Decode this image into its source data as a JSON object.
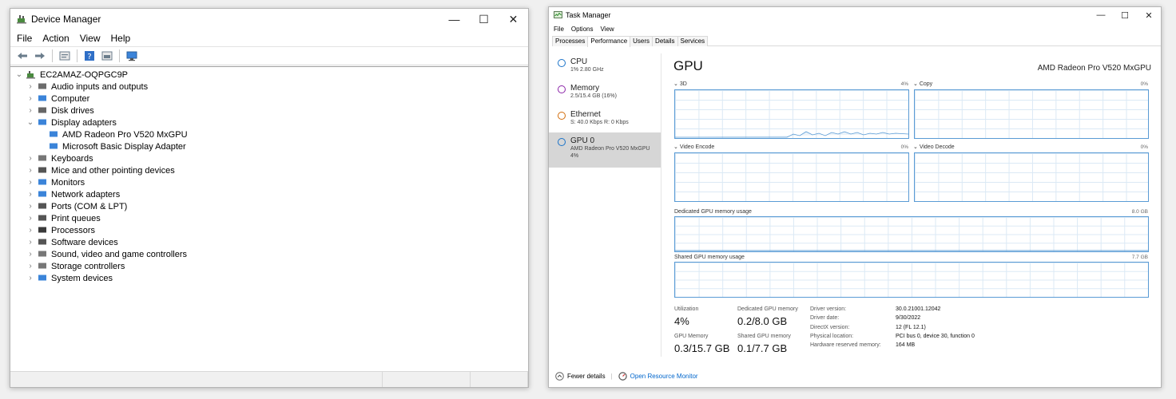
{
  "device_manager": {
    "title": "Device Manager",
    "caption": {
      "minimize": "—",
      "maximize": "☐",
      "close": "✕"
    },
    "menu": [
      "File",
      "Action",
      "View",
      "Help"
    ],
    "toolbar_icons": [
      "back-icon",
      "forward-icon",
      "properties-icon",
      "help-icon",
      "update-driver-icon",
      "monitor-icon"
    ],
    "root": "EC2AMAZ-OQPGC9P",
    "tree": [
      {
        "label": "Audio inputs and outputs",
        "icon": "speaker-icon",
        "expanded": false
      },
      {
        "label": "Computer",
        "icon": "computer-icon",
        "expanded": false
      },
      {
        "label": "Disk drives",
        "icon": "disk-icon",
        "expanded": false
      },
      {
        "label": "Display adapters",
        "icon": "display-adapter-icon",
        "expanded": true,
        "children": [
          "AMD Radeon Pro V520 MxGPU",
          "Microsoft Basic Display Adapter"
        ]
      },
      {
        "label": "Keyboards",
        "icon": "keyboard-icon",
        "expanded": false
      },
      {
        "label": "Mice and other pointing devices",
        "icon": "mouse-icon",
        "expanded": false
      },
      {
        "label": "Monitors",
        "icon": "monitor-icon",
        "expanded": false
      },
      {
        "label": "Network adapters",
        "icon": "network-icon",
        "expanded": false
      },
      {
        "label": "Ports (COM & LPT)",
        "icon": "port-icon",
        "expanded": false
      },
      {
        "label": "Print queues",
        "icon": "printer-icon",
        "expanded": false
      },
      {
        "label": "Processors",
        "icon": "processor-icon",
        "expanded": false
      },
      {
        "label": "Software devices",
        "icon": "software-device-icon",
        "expanded": false
      },
      {
        "label": "Sound, video and game controllers",
        "icon": "sound-icon",
        "expanded": false
      },
      {
        "label": "Storage controllers",
        "icon": "storage-icon",
        "expanded": false
      },
      {
        "label": "System devices",
        "icon": "system-devices-icon",
        "expanded": false
      }
    ]
  },
  "task_manager": {
    "title": "Task Manager",
    "caption": {
      "minimize": "—",
      "maximize": "☐",
      "close": "✕"
    },
    "menu": [
      "File",
      "Options",
      "View"
    ],
    "tabs": [
      {
        "label": "Processes",
        "active": false
      },
      {
        "label": "Performance",
        "active": true
      },
      {
        "label": "Users",
        "active": false
      },
      {
        "label": "Details",
        "active": false
      },
      {
        "label": "Services",
        "active": false
      }
    ],
    "sidebar": [
      {
        "name": "CPU",
        "sub": "1% 2.80 GHz",
        "color": "#1a73c9",
        "selected": false
      },
      {
        "name": "Memory",
        "sub": "2.5/15.4 GB (16%)",
        "color": "#8b23a8",
        "selected": false
      },
      {
        "name": "Ethernet",
        "sub": "S: 40.0 Kbps R: 0 Kbps",
        "color": "#d26c0a",
        "selected": false
      },
      {
        "name": "GPU 0",
        "sub": "AMD Radeon Pro V520 MxGPU",
        "sub2": "4%",
        "color": "#1a73c9",
        "selected": true
      }
    ],
    "main": {
      "title": "GPU",
      "gpu_name": "AMD Radeon Pro V520 MxGPU",
      "graphs": [
        {
          "label": "3D",
          "pct": "4%"
        },
        {
          "label": "Copy",
          "pct": "0%"
        },
        {
          "label": "Video Encode",
          "pct": "0%"
        },
        {
          "label": "Video Decode",
          "pct": "0%"
        }
      ],
      "dedicated_label": "Dedicated GPU memory usage",
      "dedicated_max": "8.0 GB",
      "shared_label": "Shared GPU memory usage",
      "shared_max": "7.7 GB",
      "stats": {
        "utilization_label": "Utilization",
        "utilization": "4%",
        "dedicated_label": "Dedicated GPU memory",
        "dedicated": "0.2/8.0 GB",
        "gpu_memory_label": "GPU Memory",
        "gpu_memory": "0.3/15.7 GB",
        "shared_label": "Shared GPU memory",
        "shared": "0.1/7.7 GB"
      },
      "details": [
        {
          "k": "Driver version:",
          "v": "30.0.21001.12042"
        },
        {
          "k": "Driver date:",
          "v": "9/30/2022"
        },
        {
          "k": "DirectX version:",
          "v": "12 (FL 12.1)"
        },
        {
          "k": "Physical location:",
          "v": "PCI bus 0, device 30, function 0"
        },
        {
          "k": "Hardware reserved memory:",
          "v": "164 MB"
        }
      ]
    },
    "footer": {
      "fewer": "Fewer details",
      "open_rm": "Open Resource Monitor"
    }
  }
}
